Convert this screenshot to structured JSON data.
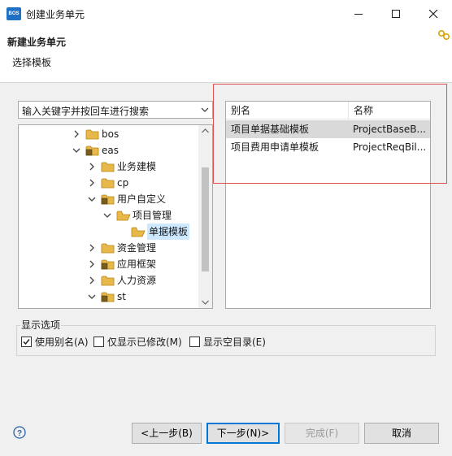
{
  "window": {
    "title": "创建业务单元",
    "app_icon_text": "BOS"
  },
  "header": {
    "heading": "新建业务单元",
    "subtitle": "选择模板"
  },
  "search": {
    "value": "输入关键字并按回车进行搜索"
  },
  "tree": [
    {
      "label": "bos",
      "expanded": false,
      "icon": "folder-icon"
    },
    {
      "label": "eas",
      "expanded": true,
      "icon": "package-folder-icon"
    },
    {
      "label": "业务建模",
      "expanded": false,
      "icon": "folder-icon"
    },
    {
      "label": "cp",
      "expanded": false,
      "icon": "folder-icon"
    },
    {
      "label": "用户自定义",
      "expanded": true,
      "icon": "package-folder-icon"
    },
    {
      "label": "项目管理",
      "expanded": true,
      "icon": "folder-open-icon"
    },
    {
      "label": "单据模板",
      "expanded": null,
      "icon": "folder-open-icon",
      "selected": true
    },
    {
      "label": "资金管理",
      "expanded": false,
      "icon": "folder-icon"
    },
    {
      "label": "应用框架",
      "expanded": false,
      "icon": "package-folder-icon"
    },
    {
      "label": "人力资源",
      "expanded": false,
      "icon": "folder-icon"
    },
    {
      "label": "st",
      "expanded": true,
      "icon": "package-folder-icon"
    }
  ],
  "table": {
    "headers": [
      "别名",
      "名称"
    ],
    "rows": [
      {
        "alias": "项目单据基础模板",
        "name": "ProjectBaseB...",
        "selected": true
      },
      {
        "alias": "项目费用申请单模板",
        "name": "ProjectReqBil...",
        "selected": false
      }
    ]
  },
  "options": {
    "legend": "显示选项",
    "use_alias": {
      "label": "使用别名(A)",
      "checked": true
    },
    "only_modified": {
      "label": "仅显示已修改(M)",
      "checked": false
    },
    "show_empty": {
      "label": "显示空目录(E)",
      "checked": false
    }
  },
  "buttons": {
    "back": "<上一步(B)",
    "next": "下一步(N)>",
    "finish": "完成(F)",
    "cancel": "取消"
  },
  "colors": {
    "highlight": "#e05050",
    "folder": "#e8b84a",
    "accent": "#0078d7"
  }
}
